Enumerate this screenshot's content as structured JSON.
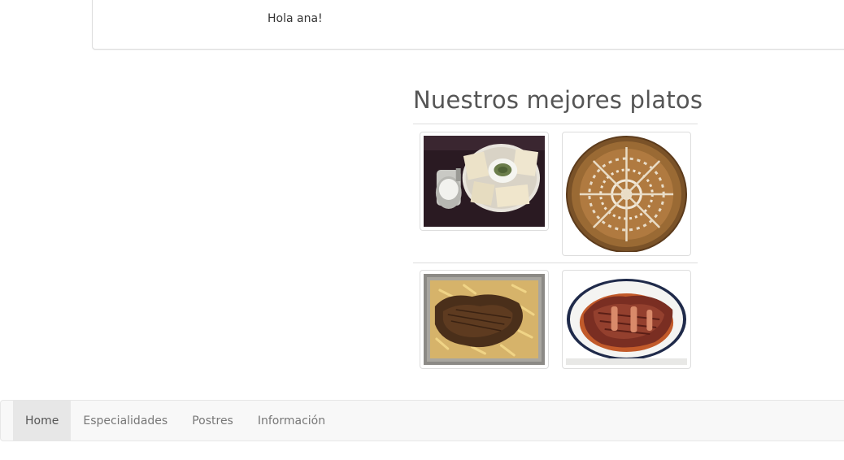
{
  "greeting": {
    "text": "Hola ana!"
  },
  "featured": {
    "title": "Nuestros mejores platos",
    "dishes": [
      {
        "icon": "dish-photo-bread-dip"
      },
      {
        "icon": "dish-photo-round-bread"
      },
      {
        "icon": "dish-photo-meat-fries"
      },
      {
        "icon": "dish-photo-ribs-plate"
      }
    ]
  },
  "navbar": {
    "items": [
      {
        "label": "Home",
        "active": true
      },
      {
        "label": "Especialidades",
        "active": false
      },
      {
        "label": "Postres",
        "active": false
      },
      {
        "label": "Información",
        "active": false
      }
    ]
  },
  "colors": {
    "heading": "#555555",
    "nav_bg": "#f8f8f8",
    "nav_active_bg": "#e7e7e7",
    "border": "#dddddd"
  }
}
